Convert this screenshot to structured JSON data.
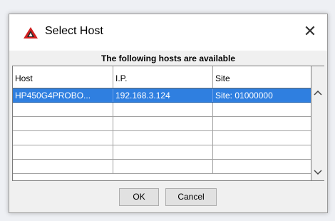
{
  "dialog": {
    "title": "Select Host",
    "close_label": "✕",
    "caption": "The following hosts are available"
  },
  "table": {
    "columns": [
      "Host",
      "I.P.",
      "Site"
    ],
    "rows": [
      [
        "HP450G4PROBO...",
        "192.168.3.124",
        "Site: 01000000"
      ],
      [
        "",
        "",
        ""
      ],
      [
        "",
        "",
        ""
      ],
      [
        "",
        "",
        ""
      ],
      [
        "",
        "",
        ""
      ],
      [
        "",
        "",
        ""
      ]
    ],
    "selected_row": 0
  },
  "scrollbar": {
    "up_icon": "chevron-up-icon",
    "down_icon": "chevron-down-icon"
  },
  "buttons": {
    "ok": "OK",
    "cancel": "Cancel"
  },
  "colors": {
    "selection": "#2f7fe0",
    "app_icon": "#d02020"
  }
}
